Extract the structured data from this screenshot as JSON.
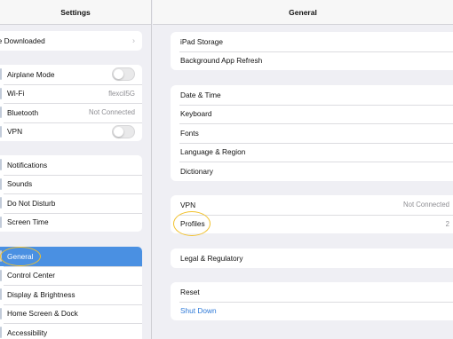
{
  "sidebar": {
    "title": "Settings",
    "banner": {
      "label": "ile Downloaded"
    },
    "connectivity": [
      {
        "label": "Airplane Mode",
        "toggle": "off"
      },
      {
        "label": "Wi-Fi",
        "value": "flexcil5G"
      },
      {
        "label": "Bluetooth",
        "value": "Not Connected"
      },
      {
        "label": "VPN",
        "toggle": "off"
      }
    ],
    "system": [
      {
        "label": "Notifications"
      },
      {
        "label": "Sounds"
      },
      {
        "label": "Do Not Disturb"
      },
      {
        "label": "Screen Time"
      }
    ],
    "general": [
      {
        "label": "General",
        "selected": true
      },
      {
        "label": "Control Center"
      },
      {
        "label": "Display & Brightness"
      },
      {
        "label": "Home Screen & Dock"
      },
      {
        "label": "Accessibility"
      }
    ]
  },
  "main": {
    "title": "General",
    "groups": {
      "storage": [
        {
          "label": "iPad Storage"
        },
        {
          "label": "Background App Refresh"
        }
      ],
      "datetime": [
        {
          "label": "Date & Time"
        },
        {
          "label": "Keyboard"
        },
        {
          "label": "Fonts"
        },
        {
          "label": "Language & Region"
        },
        {
          "label": "Dictionary"
        }
      ],
      "vpn": [
        {
          "label": "VPN",
          "value": "Not Connected"
        },
        {
          "label": "Profiles",
          "value": "2"
        }
      ],
      "legal": [
        {
          "label": "Legal & Regulatory"
        }
      ],
      "reset": [
        {
          "label": "Reset"
        },
        {
          "label": "Shut Down"
        }
      ]
    }
  },
  "colors": {
    "selected_row": "#4a90e2",
    "annotation_circle": "#f1c12d",
    "link": "#2f7ad8"
  },
  "icons": {
    "chevron": "chevron-right-icon"
  }
}
